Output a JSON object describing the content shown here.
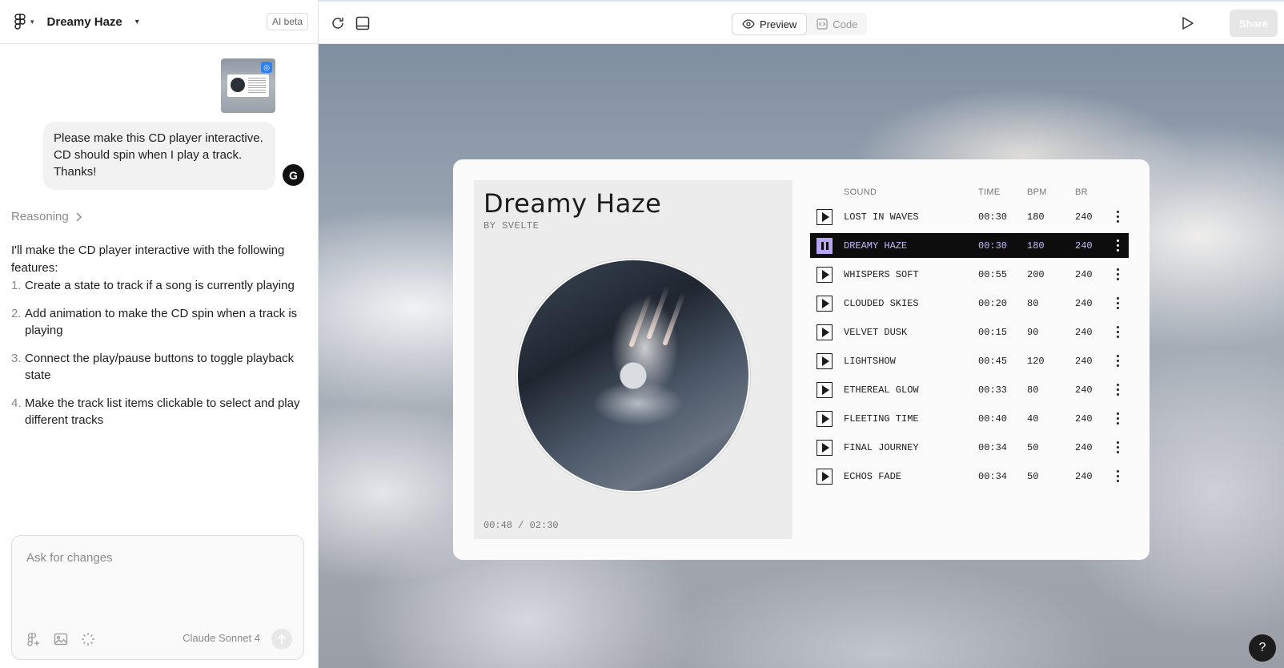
{
  "header": {
    "project_title": "Dreamy Haze",
    "ai_badge": "AI beta"
  },
  "toolbar": {
    "preview_label": "Preview",
    "code_label": "Code",
    "share_label": "Share"
  },
  "chat": {
    "user_message": "Please make this CD player interactive. CD should spin when I play a track. Thanks!",
    "avatar_letter": "G",
    "reasoning_label": "Reasoning",
    "assistant_intro": "I'll make the CD player interactive with the following features:",
    "steps": [
      {
        "num": "1.",
        "text": "Create a state to track if a song is currently playing"
      },
      {
        "num": "2.",
        "text": "Add animation to make the CD spin when a track is playing"
      },
      {
        "num": "3.",
        "text": "Connect the play/pause buttons to toggle playback state"
      },
      {
        "num": "4.",
        "text": "Make the track list items clickable to select and play different tracks"
      }
    ]
  },
  "composer": {
    "placeholder": "Ask for changes",
    "model": "Claude Sonnet 4"
  },
  "player": {
    "title": "Dreamy Haze",
    "artist": "BY SVELTE",
    "time_current": "00:48",
    "time_sep": "/",
    "time_total": "02:30",
    "columns": {
      "sound": "SOUND",
      "time": "TIME",
      "bpm": "BPM",
      "br": "BR"
    },
    "tracks": [
      {
        "name": "LOST IN WAVES",
        "time": "00:30",
        "bpm": "180",
        "br": "240"
      },
      {
        "name": "DREAMY HAZE",
        "time": "00:30",
        "bpm": "180",
        "br": "240"
      },
      {
        "name": "WHISPERS SOFT",
        "time": "00:55",
        "bpm": "200",
        "br": "240"
      },
      {
        "name": "CLOUDED SKIES",
        "time": "00:20",
        "bpm": "80",
        "br": "240"
      },
      {
        "name": "VELVET DUSK",
        "time": "00:15",
        "bpm": "90",
        "br": "240"
      },
      {
        "name": "LIGHTSHOW",
        "time": "00:45",
        "bpm": "120",
        "br": "240"
      },
      {
        "name": "ETHEREAL GLOW",
        "time": "00:33",
        "bpm": "80",
        "br": "240"
      },
      {
        "name": "FLEETING TIME",
        "time": "00:40",
        "bpm": "40",
        "br": "240"
      },
      {
        "name": "FINAL JOURNEY",
        "time": "00:34",
        "bpm": "50",
        "br": "240"
      },
      {
        "name": "ECHOS FADE",
        "time": "00:34",
        "bpm": "50",
        "br": "240"
      }
    ],
    "active_track": 1
  },
  "help": {
    "label": "?"
  },
  "colors": {
    "accent": "#b9a5f5",
    "active_row": "#0d0d0d",
    "share_disabled": "#e6e6e6"
  },
  "icons": [
    "figma-logo-icon",
    "chevron-down-icon",
    "refresh-icon",
    "panel-icon",
    "eye-icon",
    "code-icon",
    "play-icon",
    "figma-add-icon",
    "image-icon",
    "sparkle-cursor-icon",
    "send-arrow-icon",
    "kebab-menu-icon",
    "pause-icon",
    "help-icon"
  ]
}
